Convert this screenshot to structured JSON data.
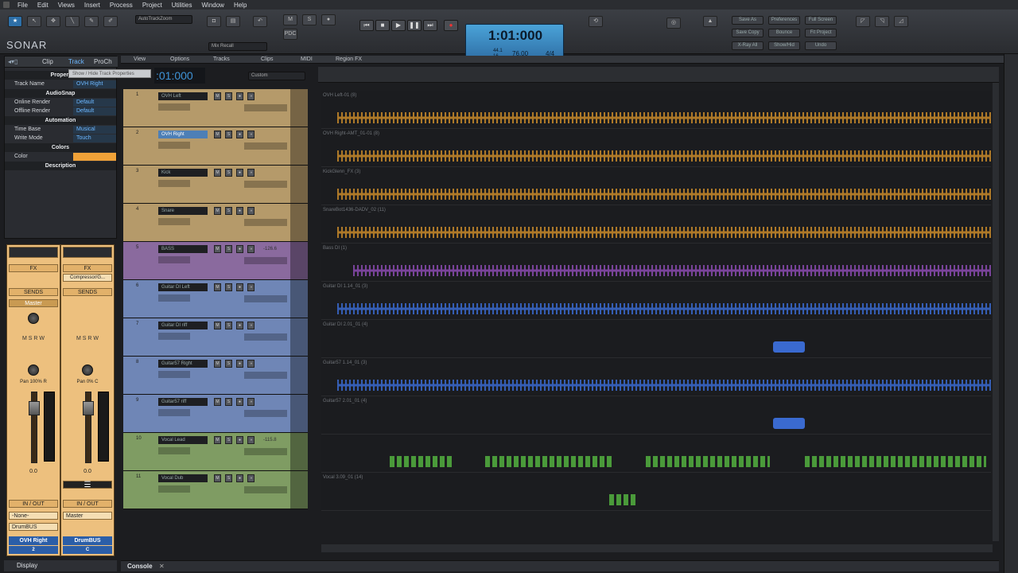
{
  "menu": [
    "File",
    "Edit",
    "Views",
    "Insert",
    "Process",
    "Project",
    "Utilities",
    "Window",
    "Help"
  ],
  "app": {
    "logo": "SONAR"
  },
  "control_bar": {
    "autotrack": "AutoTrackZoom",
    "mix_recall": "Mix Recall",
    "time": "1:01:000",
    "tempo": "76.00",
    "timesig": "4/4",
    "sig_top": "44.1",
    "sig_bottom": "16",
    "right_buttons": [
      "Save As",
      "Preferences",
      "Full Screen",
      "Save Copy",
      "Bounce",
      "Fit Project",
      "X-Ray All",
      "Show/Hid",
      "Undo"
    ],
    "transport": [
      "⏮",
      "■",
      "▶",
      "❚❚",
      "⏭",
      "●"
    ]
  },
  "inspector": {
    "tabs": [
      "Clip",
      "Track",
      "ProCh"
    ],
    "tooltip": "Show / Hide Track Properties",
    "sections": {
      "properties": "Propert",
      "audiosnap": "AudioSnap",
      "automation": "Automation",
      "colors": "Colors",
      "description": "Description"
    },
    "rows": {
      "track_name": {
        "label": "Track Name",
        "value": "OVH Right"
      },
      "online_render": {
        "label": "Online Render",
        "value": "Default"
      },
      "offline_render": {
        "label": "Offline Render",
        "value": "Default"
      },
      "time_base": {
        "label": "Time Base",
        "value": "Musical"
      },
      "write_mode": {
        "label": "Write Mode",
        "value": "Touch"
      },
      "color": {
        "label": "Color"
      }
    },
    "color": "#f0a238"
  },
  "strips": [
    {
      "fx": "FX",
      "fx_item": "",
      "sends": "SENDS",
      "send_target": "Master",
      "pan": "Pan 100% R",
      "gain": "0.0",
      "io": "IN / OUT",
      "in": "-None-",
      "out": "DrumBUS",
      "name": "OVH Right",
      "num": "2",
      "buttons": [
        "M",
        "S",
        "R",
        "W"
      ]
    },
    {
      "fx": "FX",
      "fx_item": "Compressor/G...",
      "sends": "SENDS",
      "send_target": "",
      "pan": "Pan 0% C",
      "gain": "0.0",
      "io": "IN / OUT",
      "in": "",
      "out": "Master",
      "name": "DrumBUS",
      "num": "C",
      "buttons": [
        "M",
        "S",
        "R",
        "W"
      ]
    }
  ],
  "view_menu": [
    "View",
    "Options",
    "Tracks",
    "Clips",
    "MIDI",
    "Region FX"
  ],
  "track_view": {
    "time": ":01:000",
    "custom": "Custom"
  },
  "tracks": [
    {
      "num": "1",
      "name": "OVH Left",
      "clip": "OVH Left-01 (8)",
      "vol": "",
      "color": "#b59a6a",
      "wave": "#c88a2a",
      "selected": false
    },
    {
      "num": "2",
      "name": "OVH Right",
      "clip": "OVH Right-AMT_01-01 (8)",
      "vol": "",
      "color": "#b59a6a",
      "wave": "#c88a2a",
      "selected": true
    },
    {
      "num": "3",
      "name": "Kick",
      "clip": "KickGlenn_FX (3)",
      "vol": "",
      "color": "#b59a6a",
      "wave": "#c88a2a",
      "selected": false
    },
    {
      "num": "4",
      "name": "Snare",
      "clip": "SnareBot1436-DADV_02 (11)",
      "vol": "",
      "color": "#b59a6a",
      "wave": "#c88a2a",
      "selected": false
    },
    {
      "num": "5",
      "name": "BASS",
      "clip": "Bass DI (1)",
      "vol": "-126.6",
      "color": "#8a6a9e",
      "wave": "#8a4ab0",
      "selected": false
    },
    {
      "num": "6",
      "name": "Guitar DI Left",
      "clip": "Guitar DI 1.14_01 (3)",
      "vol": "",
      "color": "#6f86b6",
      "wave": "#3a6ad0",
      "selected": false
    },
    {
      "num": "7",
      "name": "Guitar DI riff",
      "clip": "Guitar DI 2.01_01 (4)",
      "vol": "",
      "color": "#6f86b6",
      "wave": "#3a6ad0",
      "selected": false
    },
    {
      "num": "8",
      "name": "Guitar57 Right",
      "clip": "Guitar57 1.14_01 (3)",
      "vol": "",
      "color": "#6f86b6",
      "wave": "#3a6ad0",
      "selected": false
    },
    {
      "num": "9",
      "name": "Guitar57 riff",
      "clip": "Guitar57 2.01_01 (4)",
      "vol": "",
      "color": "#6f86b6",
      "wave": "#3a6ad0",
      "selected": false
    },
    {
      "num": "10",
      "name": "Vocal Lead",
      "clip": "",
      "vol": "-115.8",
      "color": "#7f9c63",
      "wave": "#4a9a3a",
      "selected": false
    },
    {
      "num": "11",
      "name": "Vocal Dub",
      "clip": "Vocal 3.09_01 (14)",
      "vol": "",
      "color": "#7f9c63",
      "wave": "#4a9a3a",
      "selected": false
    }
  ],
  "bottom": {
    "display": "Display",
    "console": "Console"
  }
}
